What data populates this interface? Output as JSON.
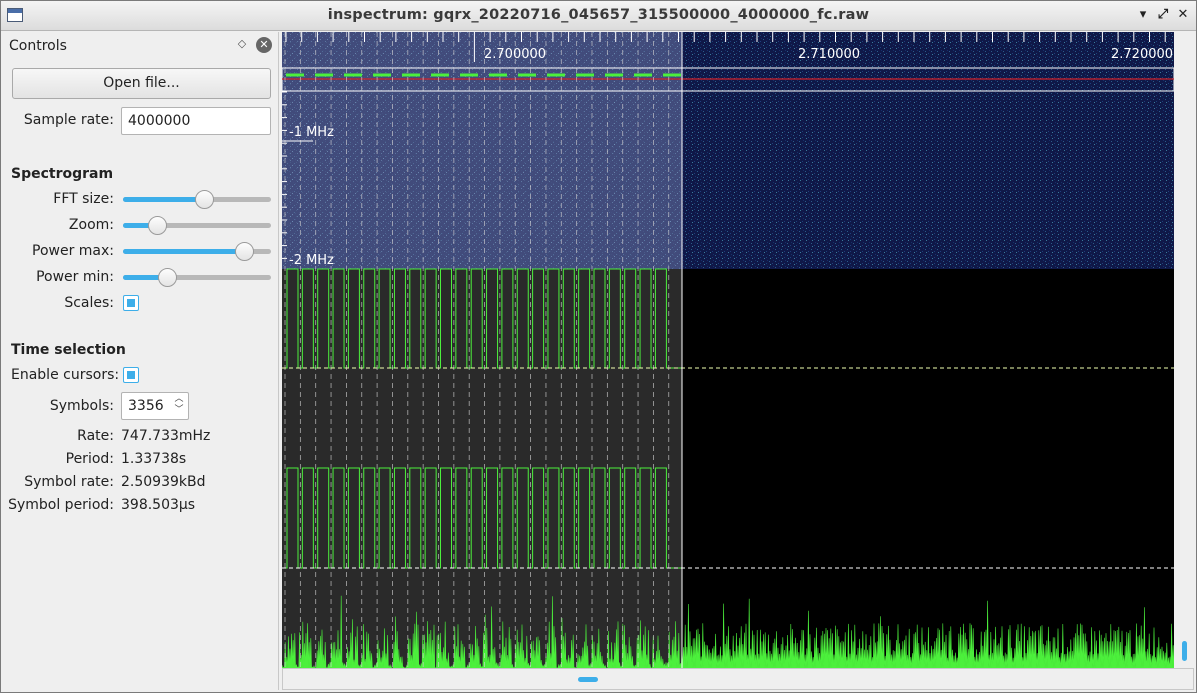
{
  "window": {
    "title": "inspectrum: gqrx_20220716_045657_315500000_4000000_fc.raw",
    "minimize_glyph": "▾",
    "maximize_glyph": "⤢",
    "close_glyph": "✕"
  },
  "controls": {
    "header": "Controls",
    "float_glyph": "◇",
    "close_glyph": "✕",
    "open_file_label": "Open file...",
    "sample_rate_label": "Sample rate:",
    "sample_rate_value": "4000000",
    "spectrogram_section": "Spectrogram",
    "fft_size_label": "FFT size:",
    "fft_size_level": 0.55,
    "zoom_label": "Zoom:",
    "zoom_level": 0.23,
    "power_max_label": "Power max:",
    "power_max_level": 0.82,
    "power_min_label": "Power min:",
    "power_min_level": 0.3,
    "scales_label": "Scales:",
    "scales_checked": true,
    "time_selection_section": "Time selection",
    "enable_cursors_label": "Enable cursors:",
    "enable_cursors_checked": true,
    "symbols_label": "Symbols:",
    "symbols_value": "3356",
    "rate_label": "Rate:",
    "rate_value": "747.733mHz",
    "period_label": "Period:",
    "period_value": "1.33738s",
    "symbol_rate_label": "Symbol rate:",
    "symbol_rate_value": "2.50939kBd",
    "symbol_period_label": "Symbol period:",
    "symbol_period_value": "398.503µs"
  },
  "plot": {
    "time_ticks": [
      "2.700000",
      "2.710000",
      "2.720000"
    ],
    "freq_ticks": [
      "-1 MHz",
      "-2 MHz"
    ],
    "colors": {
      "spectrogram_bg": "#101a4a",
      "selection_overlay": "#6a7398",
      "trace_green": "#4cf03c",
      "cursor_line": "#ffffff",
      "filter_band": "#d0202a",
      "threshold_line": "#f0ffb0"
    }
  }
}
